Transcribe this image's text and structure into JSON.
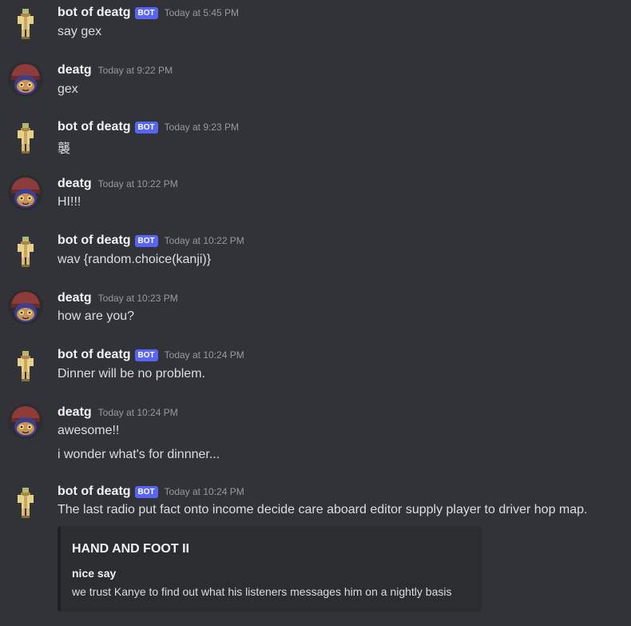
{
  "users": {
    "bot": {
      "name": "bot of deatg",
      "tag": "BOT",
      "avatar_icon": "golden-figure-icon"
    },
    "human": {
      "name": "deatg",
      "avatar_icon": "hooded-character-icon"
    }
  },
  "colors": {
    "background": "#313338",
    "bot_tag": "#5865f2",
    "timestamp": "#949ba4",
    "embed_background": "#2b2d31"
  },
  "messages": [
    {
      "author": "bot of deatg",
      "is_bot": true,
      "time": "Today at 5:45 PM",
      "lines": [
        "say gex"
      ]
    },
    {
      "author": "deatg",
      "is_bot": false,
      "time": "Today at 9:22 PM",
      "lines": [
        "gex"
      ]
    },
    {
      "author": "bot of deatg",
      "is_bot": true,
      "time": "Today at 9:23 PM",
      "lines": [
        "襲"
      ]
    },
    {
      "author": "deatg",
      "is_bot": false,
      "time": "Today at 10:22 PM",
      "lines": [
        "HI!!!"
      ]
    },
    {
      "author": "bot of deatg",
      "is_bot": true,
      "time": "Today at 10:22 PM",
      "lines": [
        "wav {random.choice(kanji)}"
      ]
    },
    {
      "author": "deatg",
      "is_bot": false,
      "time": "Today at 10:23 PM",
      "lines": [
        "how are you?"
      ]
    },
    {
      "author": "bot of deatg",
      "is_bot": true,
      "time": "Today at 10:24 PM",
      "lines": [
        "Dinner will be no problem."
      ]
    },
    {
      "author": "deatg",
      "is_bot": false,
      "time": "Today at 10:24 PM",
      "lines": [
        "awesome!!",
        "i wonder what's for dinnner..."
      ]
    },
    {
      "author": "bot of deatg",
      "is_bot": true,
      "time": "Today at 10:24 PM",
      "lines": [
        "The last radio put fact onto income decide care aboard editor supply player to driver hop map."
      ]
    }
  ],
  "embed": {
    "title": "HAND AND FOOT II",
    "field_name": "nice say",
    "field_value": "we trust Kanye to find out what his listeners messages him on a nightly basis"
  }
}
